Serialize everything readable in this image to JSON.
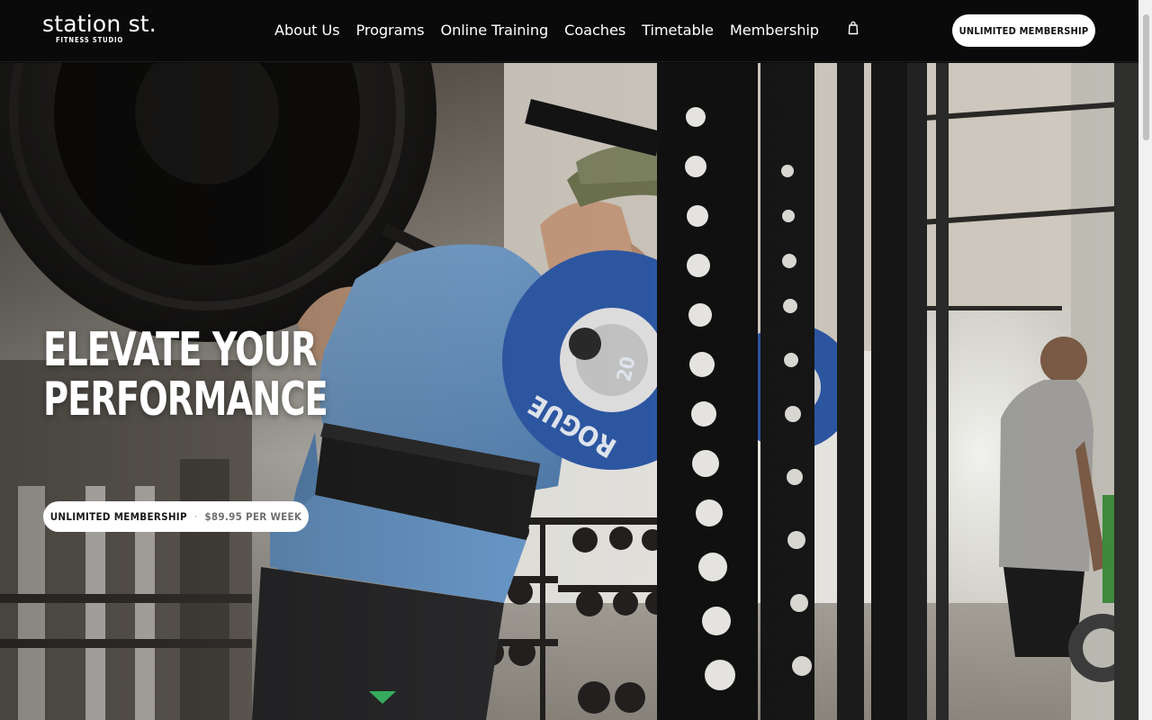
{
  "brand": {
    "name": "station st.",
    "tagline": "FITNESS STUDIO"
  },
  "nav": {
    "items": [
      "About Us",
      "Programs",
      "Online Training",
      "Coaches",
      "Timetable",
      "Membership"
    ],
    "cart_icon": "shopping-bag-icon"
  },
  "header_cta": {
    "label": "UNLIMITED MEMBERSHIP"
  },
  "hero": {
    "title_line1": "ELEVATE YOUR",
    "title_line2": "PERFORMANCE",
    "cta_label": "UNLIMITED MEMBERSHIP",
    "cta_separator": "·",
    "cta_price": "$89.95 PER WEEK",
    "plate_text": "ROGUE",
    "plate_weight": "20",
    "image_subject": "athlete-squatting-barbell-in-gym"
  },
  "colors": {
    "header_bg": "#0a0a0a",
    "accent": "#ffffff",
    "shirt_blue": "#6e9ccd",
    "plate_blue": "#2f5aa8"
  }
}
